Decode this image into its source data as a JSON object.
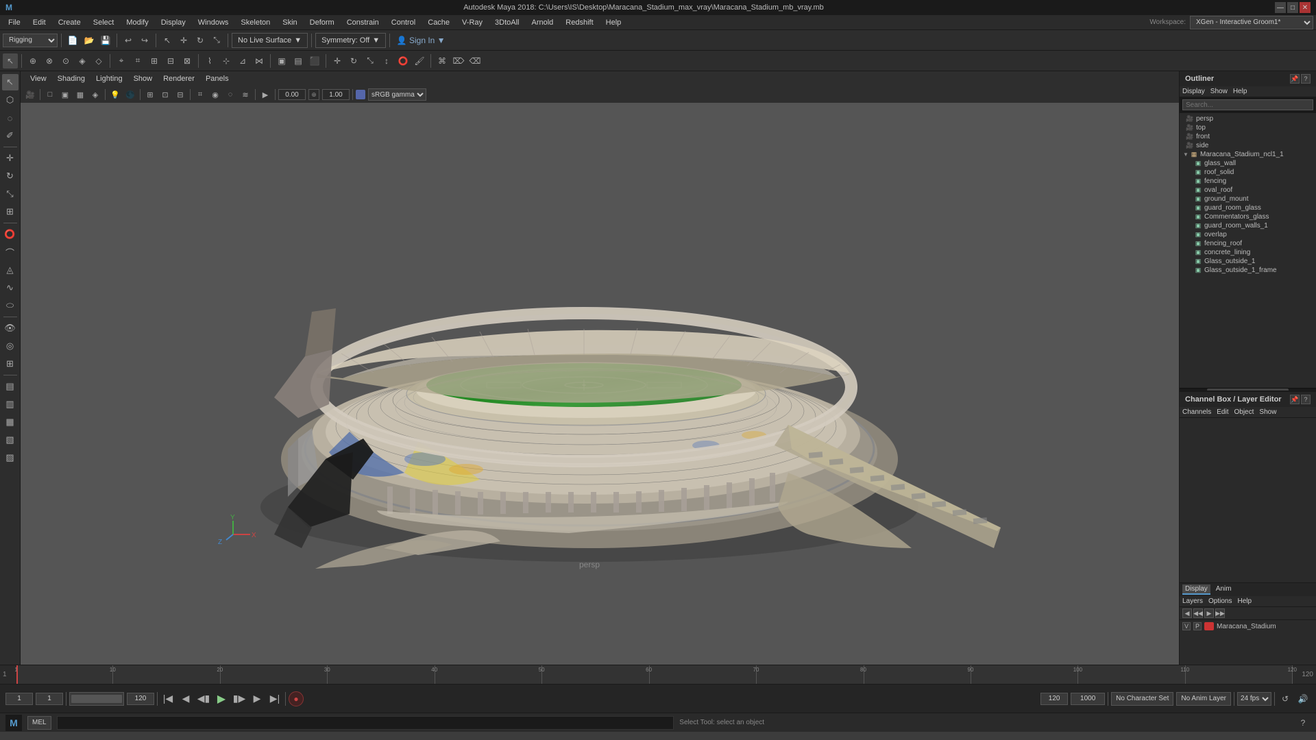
{
  "window": {
    "title": "Autodesk Maya 2018: C:\\Users\\IS\\Desktop\\Maracana_Stadium_max_vray\\Maracana_Stadium_mb_vray.mb",
    "controls": [
      "—",
      "□",
      "✕"
    ]
  },
  "menubar": {
    "items": [
      "File",
      "Edit",
      "Create",
      "Select",
      "Modify",
      "Display",
      "Windows",
      "Skeleton",
      "Skin",
      "Deform",
      "Constrain",
      "Control",
      "Cache",
      "V-Ray",
      "3DtoAll",
      "Arnold",
      "Redshift",
      "Help"
    ]
  },
  "toolbar": {
    "workspace_label": "Workspace:",
    "workspace_value": "XGen - Interactive Groom1*",
    "rigging": "Rigging",
    "no_live_surface": "No Live Surface",
    "symmetry_off": "Symmetry: Off"
  },
  "viewport": {
    "menu_items": [
      "View",
      "Shading",
      "Lighting",
      "Show",
      "Renderer",
      "Panels"
    ],
    "persp_label": "persp",
    "value1": "0.00",
    "value2": "1.00",
    "color_space": "sRGB gamma"
  },
  "outliner": {
    "title": "Outliner",
    "menu_items": [
      "Display",
      "Show",
      "Help"
    ],
    "search_placeholder": "Search...",
    "tree_items": [
      {
        "name": "persp",
        "type": "camera",
        "indent": 0,
        "arrow": "▶"
      },
      {
        "name": "top",
        "type": "camera",
        "indent": 0,
        "arrow": "▶"
      },
      {
        "name": "front",
        "type": "camera",
        "indent": 0,
        "arrow": "▶"
      },
      {
        "name": "side",
        "type": "camera",
        "indent": 0,
        "arrow": "▶"
      },
      {
        "name": "Maracana_Stadium_ncl1_1",
        "type": "group",
        "indent": 0,
        "arrow": "▼"
      },
      {
        "name": "glass_wall",
        "type": "mesh",
        "indent": 1,
        "arrow": ""
      },
      {
        "name": "roof_solid",
        "type": "mesh",
        "indent": 1,
        "arrow": ""
      },
      {
        "name": "fencing",
        "type": "mesh",
        "indent": 1,
        "arrow": ""
      },
      {
        "name": "oval_roof",
        "type": "mesh",
        "indent": 1,
        "arrow": ""
      },
      {
        "name": "ground_mount",
        "type": "mesh",
        "indent": 1,
        "arrow": ""
      },
      {
        "name": "guard_room_glass",
        "type": "mesh",
        "indent": 1,
        "arrow": ""
      },
      {
        "name": "Commentators_glass",
        "type": "mesh",
        "indent": 1,
        "arrow": ""
      },
      {
        "name": "guard_room_walls_1",
        "type": "mesh",
        "indent": 1,
        "arrow": ""
      },
      {
        "name": "overlap",
        "type": "mesh",
        "indent": 1,
        "arrow": ""
      },
      {
        "name": "fencing_roof",
        "type": "mesh",
        "indent": 1,
        "arrow": ""
      },
      {
        "name": "concrete_lining",
        "type": "mesh",
        "indent": 1,
        "arrow": ""
      },
      {
        "name": "Glass_outside_1",
        "type": "mesh",
        "indent": 1,
        "arrow": ""
      },
      {
        "name": "Glass_outside_1_frame",
        "type": "mesh",
        "indent": 1,
        "arrow": ""
      }
    ]
  },
  "channel_box": {
    "title": "Channel Box / Layer Editor",
    "menu_items": [
      "Channels",
      "Edit",
      "Object",
      "Show"
    ]
  },
  "display_layer": {
    "tabs": [
      "Display",
      "Anim"
    ],
    "active_tab": "Display",
    "menu_items": [
      "Layers",
      "Options",
      "Help"
    ],
    "layer": {
      "v": "V",
      "p": "P",
      "color": "#cc3333",
      "name": "Maracana_Stadium"
    }
  },
  "timeline": {
    "start": "1",
    "end": "120",
    "range_start": "1",
    "range_end": "120",
    "end2": "1000",
    "ticks": [
      1,
      10,
      20,
      30,
      40,
      50,
      60,
      70,
      80,
      90,
      100,
      110,
      120
    ],
    "current_frame": "1"
  },
  "bottom_controls": {
    "range_start": "1",
    "range_end": "120",
    "range_end2": "120",
    "range_total": "1000",
    "fps": "24 fps",
    "no_character_set": "No Character Set",
    "no_anim_layer": "No Anim Layer",
    "no_character": "No Character"
  },
  "statusbar": {
    "mel_label": "MEL",
    "status_text": "Select Tool: select an object",
    "maya_logo": "M"
  },
  "icons": {
    "camera": "🎥",
    "mesh": "▣",
    "group": "▦",
    "arrow_right": "▶",
    "arrow_down": "▼",
    "play": "▶",
    "prev": "◀◀",
    "next": "▶▶",
    "step_back": "◀",
    "step_fwd": "▶",
    "stop": "■"
  }
}
